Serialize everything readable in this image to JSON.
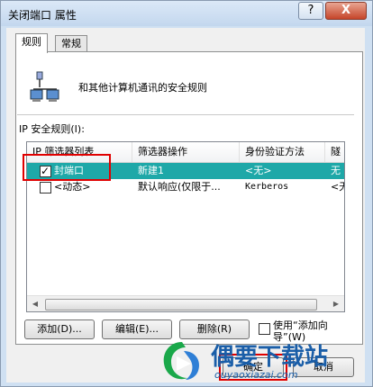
{
  "window": {
    "title": "关闭端口 属性",
    "help": "?",
    "close": "X"
  },
  "tabs": [
    {
      "label": "规则"
    },
    {
      "label": "常规"
    }
  ],
  "description": "和其他计算机通讯的安全规则",
  "rules_label": "IP 安全规则(I):",
  "columns": [
    "IP 筛选器列表",
    "筛选器操作",
    "身份验证方法",
    "隧"
  ],
  "rows": [
    {
      "checked": true,
      "cells": [
        "封端口",
        "新建1",
        "<无>",
        "无"
      ]
    },
    {
      "checked": false,
      "cells": [
        "<动态>",
        "默认响应(仅限于...",
        "Kerberos",
        "<无"
      ]
    }
  ],
  "buttons": {
    "add": "添加(D)...",
    "edit": "编辑(E)...",
    "remove": "删除(R)"
  },
  "use_wizard": "使用“添加向导”(W)",
  "ok": "确定",
  "cancel": "取消",
  "watermark": {
    "cn": "偶要下载站",
    "url": "ouyaoxiazai.com"
  },
  "colors": {
    "selection": "#1ea8a8",
    "highlight_box": "#e00000",
    "watermark": "#1a5ea8"
  }
}
